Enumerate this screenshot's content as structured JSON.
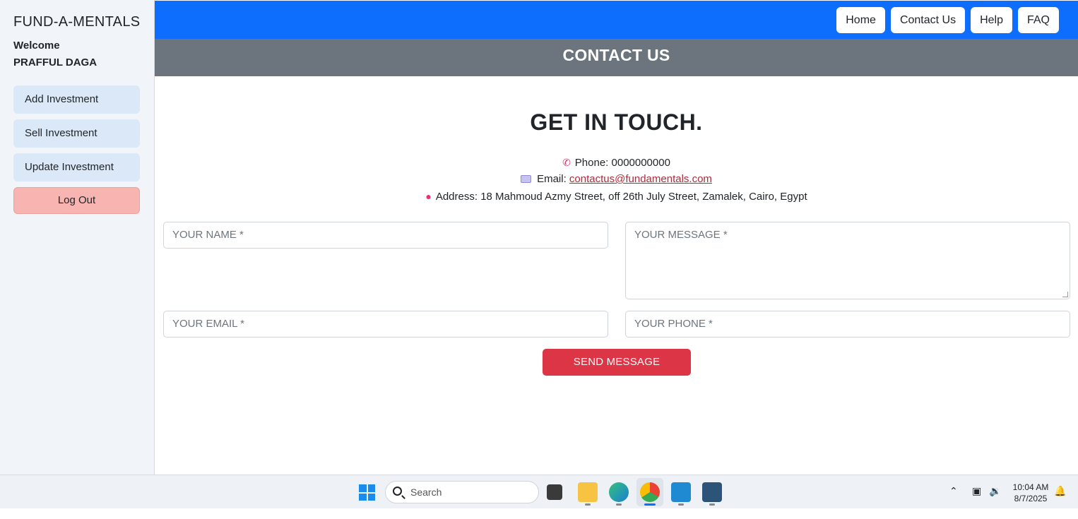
{
  "sidebar": {
    "brand": "FUND-A-MENTALS",
    "welcome": "Welcome",
    "user": "PRAFFUL DAGA",
    "items": [
      {
        "label": "Add Investment"
      },
      {
        "label": "Sell Investment"
      },
      {
        "label": "Update Investment"
      }
    ],
    "logout": "Log Out"
  },
  "topnav": {
    "links": [
      {
        "label": "Home"
      },
      {
        "label": "Contact Us"
      },
      {
        "label": "Help"
      },
      {
        "label": "FAQ"
      }
    ]
  },
  "band": {
    "title": "CONTACT US"
  },
  "main": {
    "heading": "GET IN TOUCH.",
    "phone_label": "Phone: 0000000000",
    "email_prefix": "Email:",
    "email_address": "contactus@fundamentals.com",
    "address_label": "Address: 18 Mahmoud Azmy Street, off 26th July Street, Zamalek, Cairo, Egypt",
    "form": {
      "name_placeholder": "YOUR NAME *",
      "message_placeholder": "YOUR MESSAGE *",
      "email_placeholder": "YOUR EMAIL *",
      "phone_placeholder": "YOUR PHONE *",
      "send_label": "SEND MESSAGE"
    }
  },
  "taskbar": {
    "search_placeholder": "Search",
    "time": "10:04 AM",
    "date": "8/7/2025",
    "apps": [
      "task-view-icon",
      "file-explorer-icon",
      "edge-icon",
      "chrome-icon",
      "vscode-icon",
      "mysql-workbench-icon"
    ]
  },
  "colors": {
    "nav_blue": "#0d6efd",
    "band_gray": "#6c757d",
    "send_red": "#dc3545",
    "logout_pink": "#f8b4b0",
    "sidebar_item": "#dbe8f7"
  }
}
